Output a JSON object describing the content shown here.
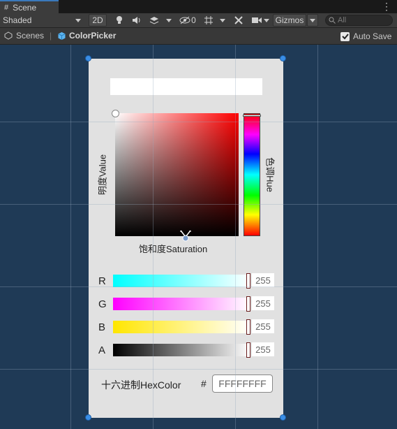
{
  "tab": {
    "label": "Scene"
  },
  "toolbar": {
    "shading_mode": "Shaded",
    "mode_2d": "2D",
    "hidden_count": "0",
    "gizmos": "Gizmos",
    "search_placeholder": "All"
  },
  "breadcrumb": {
    "root": "Scenes",
    "current": "ColorPicker",
    "auto_save": "Auto Save",
    "auto_save_checked": true
  },
  "picker": {
    "value_label": "明度Value",
    "hue_label": "色调Hue",
    "saturation_label": "饱和度Saturation",
    "sliders": [
      {
        "channel": "R",
        "value": "255",
        "color": "#00ffff"
      },
      {
        "channel": "G",
        "value": "255",
        "color": "#ff00ff"
      },
      {
        "channel": "B",
        "value": "255",
        "color": "#ffe600"
      },
      {
        "channel": "A",
        "value": "255",
        "color": "#000000"
      }
    ],
    "hex_label": "十六进制HexColor",
    "hash": "#",
    "hex_value": "FFFFFFFF"
  }
}
